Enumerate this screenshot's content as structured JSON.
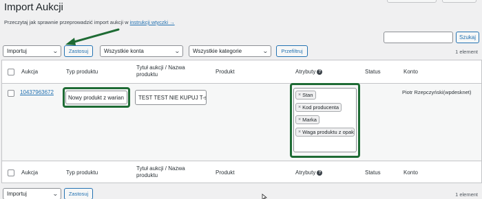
{
  "page": {
    "title": "Import Aukcji",
    "help_prefix": "Przeczytaj jak sprawnie przeprowadzić import aukcji w ",
    "help_link": "instrukcji wtyczki →"
  },
  "search": {
    "value": "",
    "button": "Szukaj"
  },
  "top_bar": {
    "bulk_action": "Importuj",
    "apply": "Zastosuj",
    "accounts_filter": "Wszystkie konta",
    "categories_filter": "Wszystkie kategorie",
    "filter_button": "Przefiltruj",
    "count": "1 element"
  },
  "bottom_bar": {
    "bulk_action": "Importuj",
    "apply": "Zastosuj",
    "count": "1 element"
  },
  "table": {
    "columns": {
      "auction": "Aukcja",
      "type": "Typ produktu",
      "title_line1": "Tytuł aukcji / Nazwa",
      "title_line2": "produktu",
      "product": "Produkt",
      "attributes": "Atrybuty",
      "status": "Status",
      "account": "Konto"
    },
    "rows": [
      {
        "auction_id": "10437963672",
        "product_type": "Nowy produkt z warian",
        "title": "TEST TEST NIE KUPUJ T-shirt",
        "attributes": [
          "Stan",
          "Kod producenta",
          "Marka",
          "Waga produktu z opakowaniem"
        ],
        "account": "Piotr Rzepczyński(wpdesknet)"
      }
    ]
  },
  "colors": {
    "highlight": "#1e6b34",
    "link": "#2271b1",
    "background": "#f0f0f1"
  },
  "icons": {
    "tag_remove": "×",
    "help": "?",
    "chevron": "⌄"
  }
}
